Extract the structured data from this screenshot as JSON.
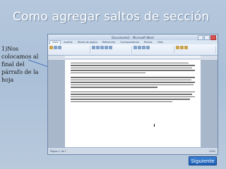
{
  "slide": {
    "title": "Como agregar saltos de sección",
    "caption": "1)Nos colocamos al final del párrafo de la hoja",
    "next_label": "Siguiente"
  },
  "screenshot": {
    "app_title": "Documento1 - Microsoft Word",
    "ribbon_tabs": [
      "Inicio",
      "Insertar",
      "Diseño de página",
      "Referencias",
      "Correspondencia",
      "Revisar",
      "Vista"
    ],
    "status_left": "Página: 1 de 1",
    "status_right": "100%"
  },
  "colors": {
    "background": "#aac0d8",
    "title_text": "#ffffff",
    "next_button": "#1f5fb3",
    "pointer_line": "#2d5fb0"
  }
}
